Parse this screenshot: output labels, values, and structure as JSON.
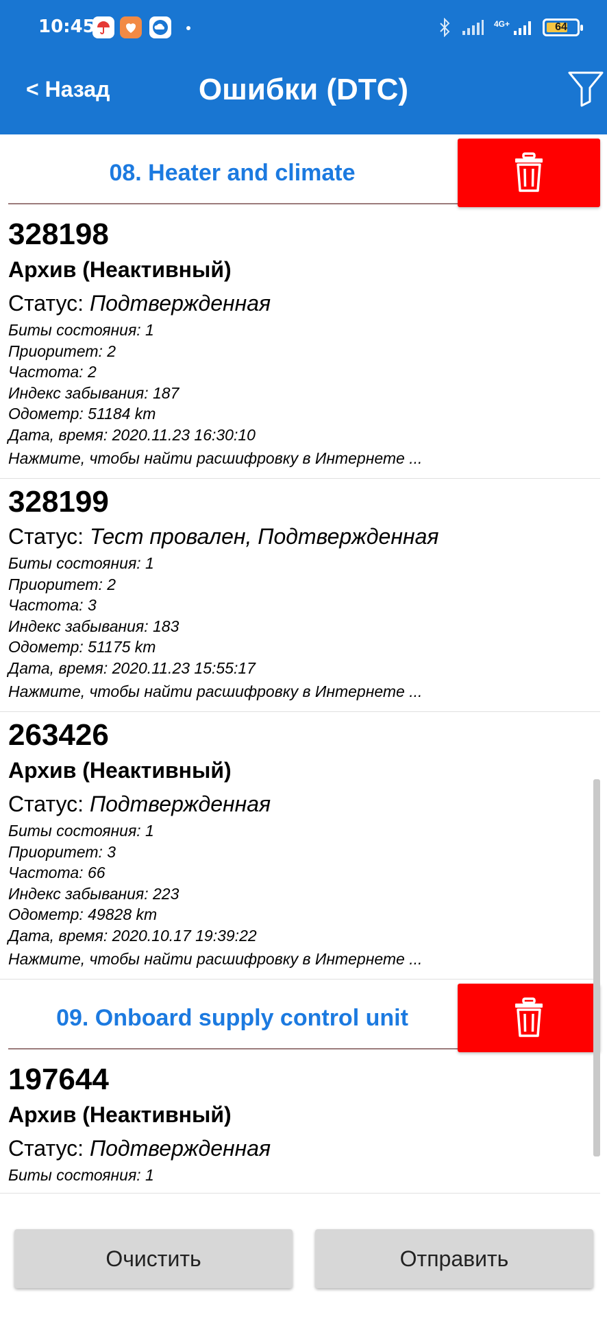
{
  "status_bar": {
    "time": "10:45",
    "battery": "64",
    "network": "4G+"
  },
  "header": {
    "back_label": "< Назад",
    "title": "Ошибки (DTC)",
    "filter_icon": "filter-icon",
    "bg_color": "#1976d2"
  },
  "groups": [
    {
      "title": "08. Heater and climate",
      "items": [
        {
          "code": "328198",
          "archive": "Архив (Неактивный)",
          "status_prefix": "Статус: ",
          "status_value": "Подтвержденная",
          "fields": [
            "Биты состояния: 1",
            "Приоритет: 2",
            "Частота: 2",
            "Индекс забывания: 187",
            "Одометр: 51184 km",
            "Дата, время: 2020.11.23 16:30:10"
          ],
          "hint": "Нажмите, чтобы найти расшифровку в Интернете ..."
        },
        {
          "code": "328199",
          "archive": "",
          "status_prefix": "Статус: ",
          "status_value": "Тест провален, Подтвержденная",
          "fields": [
            "Биты состояния: 1",
            "Приоритет: 2",
            "Частота: 3",
            "Индекс забывания: 183",
            "Одометр: 51175 km",
            "Дата, время: 2020.11.23 15:55:17"
          ],
          "hint": "Нажмите, чтобы найти расшифровку в Интернете ..."
        },
        {
          "code": "263426",
          "archive": "Архив (Неактивный)",
          "status_prefix": "Статус: ",
          "status_value": "Подтвержденная",
          "fields": [
            "Биты состояния: 1",
            "Приоритет: 3",
            "Частота: 66",
            "Индекс забывания: 223",
            "Одометр: 49828 km",
            "Дата, время: 2020.10.17 19:39:22"
          ],
          "hint": "Нажмите, чтобы найти расшифровку в Интернете ..."
        }
      ]
    },
    {
      "title": "09. Onboard supply control unit",
      "items": [
        {
          "code": "197644",
          "archive": "Архив (Неактивный)",
          "status_prefix": "Статус: ",
          "status_value": "Подтвержденная",
          "fields": [
            "Биты состояния: 1"
          ],
          "hint": ""
        }
      ]
    }
  ],
  "buttons": {
    "clear": "Очистить",
    "send": "Отправить"
  },
  "colors": {
    "accent": "#1c7ae0",
    "delete": "#ff0000",
    "button": "#d7d7d7"
  }
}
